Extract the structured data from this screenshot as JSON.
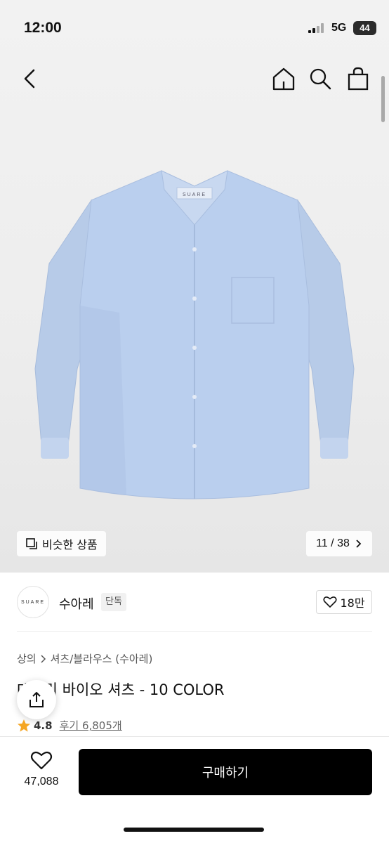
{
  "status_bar": {
    "time": "12:00",
    "network": "5G",
    "battery": "44"
  },
  "overlay": {
    "similar_label": "비슷한 상품",
    "page_indicator": "11 / 38"
  },
  "brand": {
    "logo_text": "SUARE",
    "name": "수아레",
    "badge": "단독",
    "like_count": "18만"
  },
  "breadcrumb": {
    "category": "상의",
    "subcategory": "셔츠/블라우스 (수아레)"
  },
  "product": {
    "title": "데일리 바이오 셔츠 - 10 COLOR",
    "rating": "4.8",
    "reviews": "후기 6,805개"
  },
  "bottom": {
    "wish_count": "47,088",
    "buy_label": "구매하기"
  },
  "colors": {
    "shirt": "#b9cdea",
    "accent_star": "#f5a623",
    "buy_button": "#000000"
  },
  "icons": [
    "back-icon",
    "home-icon",
    "search-icon",
    "bag-icon",
    "copy-icon",
    "chevron-right-icon",
    "heart-icon",
    "share-icon",
    "star-icon"
  ]
}
